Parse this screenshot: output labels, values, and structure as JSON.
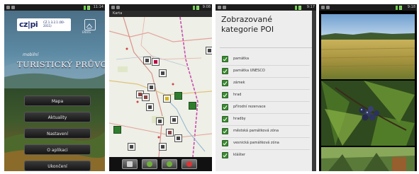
{
  "screen1": {
    "logo_text": "cz|pi",
    "logo_sub": "CZ.1.3.2.1 (00-2011)",
    "emblem_label": "ENVIS",
    "tagline": "mobilní",
    "title": "TURISTICKÝ PRŮVODCE",
    "menu": [
      "Mapa",
      "Aktuality",
      "Nastavení",
      "O aplikaci",
      "Ukončení"
    ],
    "status_time": "11:14"
  },
  "screen2": {
    "title": "Karta",
    "status_time": "9:08"
  },
  "screen3": {
    "heading": "Zobrazované kategorie POI",
    "items": [
      "památka",
      "památka UNESCO",
      "zámek",
      "hrad",
      "přírodní rezervace",
      "hradby",
      "městská památková zóna",
      "vesnická památková zóna",
      "klášter"
    ],
    "status_time": "9:17"
  },
  "screen4": {
    "status_time": "9:18"
  },
  "colors": {
    "checkbox": "#3d8a34",
    "statusbar": "#1c1c1c",
    "map_bg": "#eeefe6"
  }
}
